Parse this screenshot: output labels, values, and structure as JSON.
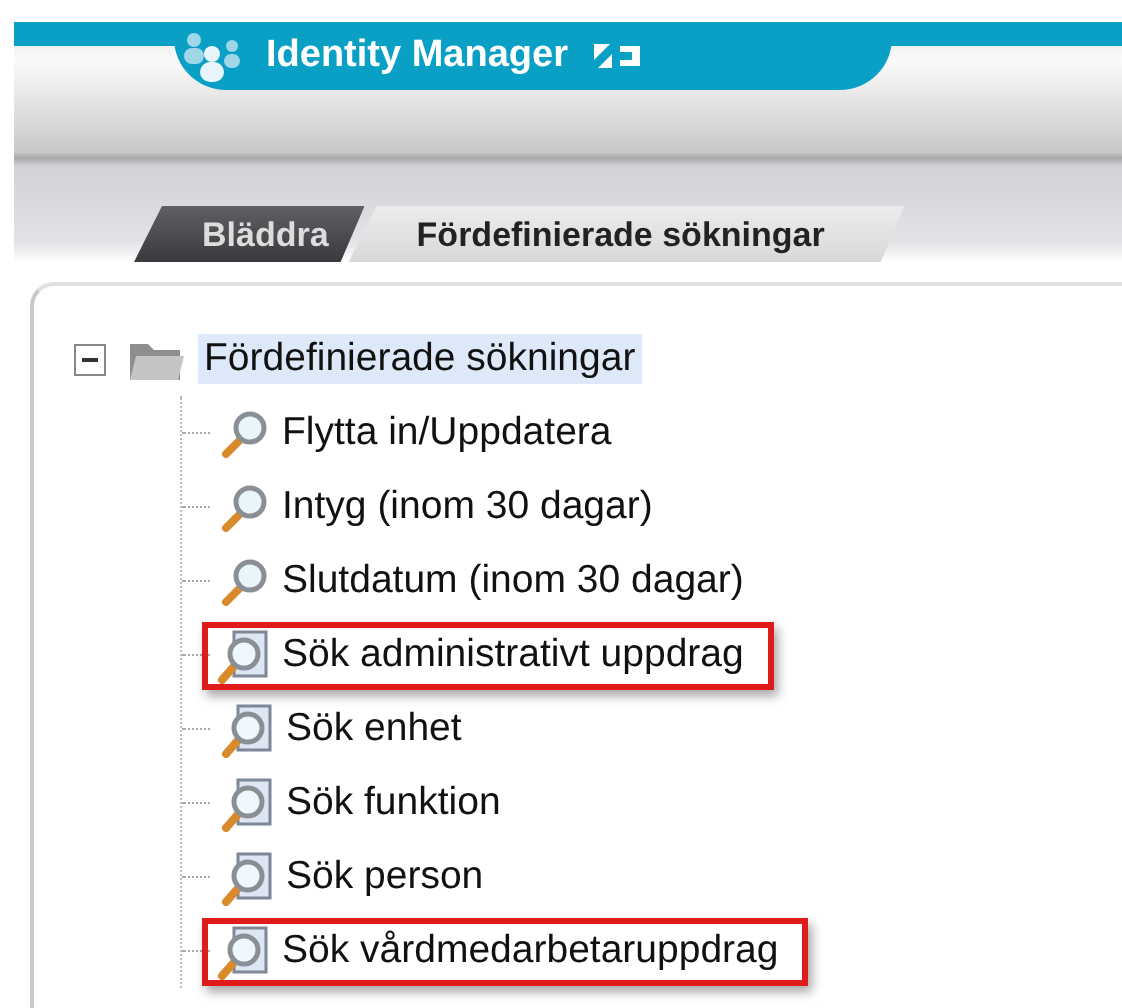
{
  "header": {
    "title": "Identity Manager"
  },
  "tabs": [
    {
      "label": "Bläddra",
      "selected": false
    },
    {
      "label": "Fördefinierade sökningar",
      "selected": true
    }
  ],
  "tree": {
    "label": "Fördefinierade sökningar",
    "expanded": true,
    "selected": true,
    "children": [
      {
        "label": "Flytta in/Uppdatera",
        "kind": "search",
        "highlighted": false
      },
      {
        "label": "Intyg (inom 30 dagar)",
        "kind": "search",
        "highlighted": false
      },
      {
        "label": "Slutdatum (inom 30 dagar)",
        "kind": "search",
        "highlighted": false
      },
      {
        "label": "Sök administrativt uppdrag",
        "kind": "doc-search",
        "highlighted": true
      },
      {
        "label": "Sök enhet",
        "kind": "doc-search",
        "highlighted": false
      },
      {
        "label": "Sök funktion",
        "kind": "doc-search",
        "highlighted": false
      },
      {
        "label": "Sök person",
        "kind": "doc-search",
        "highlighted": false
      },
      {
        "label": "Sök vårdmedarbetaruppdrag",
        "kind": "doc-search",
        "highlighted": true
      }
    ]
  }
}
